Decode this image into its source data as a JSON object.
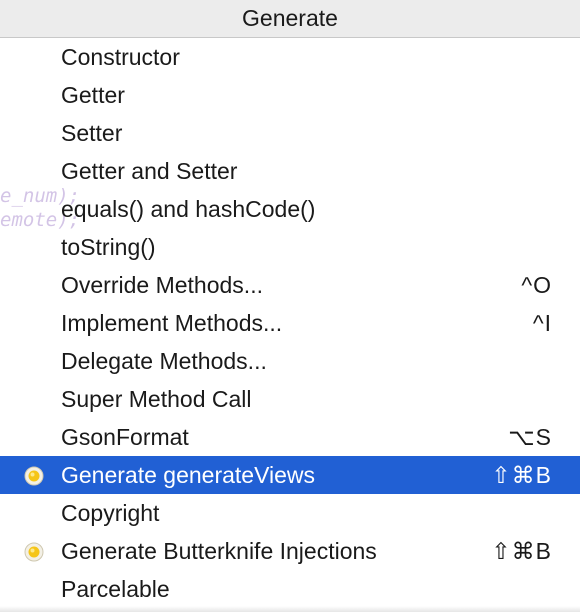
{
  "header": {
    "title": "Generate"
  },
  "background_code": {
    "line1": "e_num);",
    "line2": "emote);"
  },
  "menu": {
    "items": [
      {
        "label": "Constructor",
        "shortcut": ""
      },
      {
        "label": "Getter",
        "shortcut": ""
      },
      {
        "label": "Setter",
        "shortcut": ""
      },
      {
        "label": "Getter and Setter",
        "shortcut": ""
      },
      {
        "label": "equals() and hashCode()",
        "shortcut": ""
      },
      {
        "label": "toString()",
        "shortcut": ""
      },
      {
        "label": "Override Methods...",
        "shortcut": "^O"
      },
      {
        "label": "Implement Methods...",
        "shortcut": "^I"
      },
      {
        "label": "Delegate Methods...",
        "shortcut": ""
      },
      {
        "label": "Super Method Call",
        "shortcut": ""
      },
      {
        "label": "GsonFormat",
        "shortcut": "⌥S"
      },
      {
        "label": "Generate generateViews",
        "shortcut": "⇧⌘B",
        "icon": "plugin-icon",
        "selected": true
      },
      {
        "label": "Copyright",
        "shortcut": ""
      },
      {
        "label": "Generate Butterknife Injections",
        "shortcut": "⇧⌘B",
        "icon": "plugin-icon"
      },
      {
        "label": "Parcelable",
        "shortcut": ""
      }
    ]
  },
  "colors": {
    "selection": "#2160d4",
    "header_bg": "#ececec",
    "text": "#1a1a1a"
  }
}
